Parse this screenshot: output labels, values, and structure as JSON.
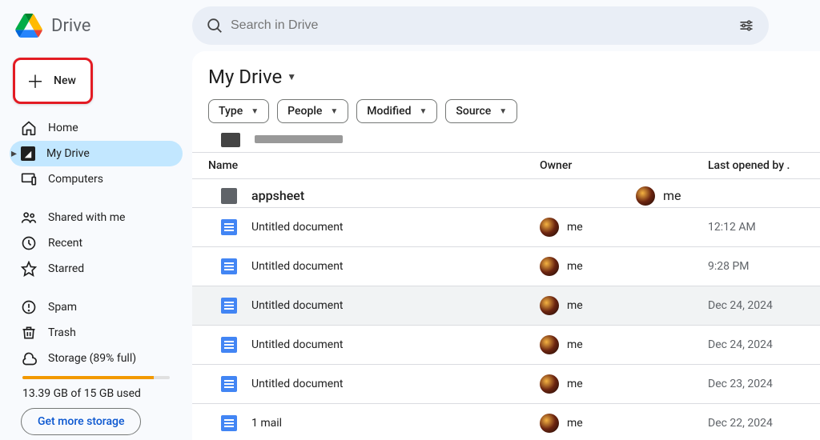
{
  "app": {
    "name": "Drive"
  },
  "search": {
    "placeholder": "Search in Drive"
  },
  "new_button": {
    "label": "New"
  },
  "sidebar": {
    "items": [
      {
        "label": "Home",
        "icon": "home-icon"
      },
      {
        "label": "My Drive",
        "icon": "drive-icon",
        "active": true
      },
      {
        "label": "Computers",
        "icon": "computers-icon"
      },
      {
        "label": "Shared with me",
        "icon": "shared-icon"
      },
      {
        "label": "Recent",
        "icon": "recent-icon"
      },
      {
        "label": "Starred",
        "icon": "starred-icon"
      },
      {
        "label": "Spam",
        "icon": "spam-icon"
      },
      {
        "label": "Trash",
        "icon": "trash-icon"
      },
      {
        "label": "Storage (89% full)",
        "icon": "storage-icon"
      }
    ]
  },
  "storage": {
    "percent": 89,
    "text": "13.39 GB of 15 GB used",
    "button": "Get more storage"
  },
  "breadcrumb": {
    "title": "My Drive"
  },
  "filters": [
    {
      "label": "Type"
    },
    {
      "label": "People"
    },
    {
      "label": "Modified"
    },
    {
      "label": "Source"
    }
  ],
  "columns": {
    "name": "Name",
    "owner": "Owner",
    "date": "Last opened by ."
  },
  "rows": [
    {
      "name": "appsheet",
      "owner": "me",
      "date": "",
      "type": "folder"
    },
    {
      "name": "Untitled document",
      "owner": "me",
      "date": "12:12 AM",
      "type": "doc"
    },
    {
      "name": "Untitled document",
      "owner": "me",
      "date": "9:28 PM",
      "type": "doc"
    },
    {
      "name": "Untitled document",
      "owner": "me",
      "date": "Dec 24, 2024",
      "type": "doc",
      "hover": true
    },
    {
      "name": "Untitled document",
      "owner": "me",
      "date": "Dec 24, 2024",
      "type": "doc"
    },
    {
      "name": "Untitled document",
      "owner": "me",
      "date": "Dec 23, 2024",
      "type": "doc"
    },
    {
      "name": "1 mail",
      "owner": "me",
      "date": "Dec 22, 2024",
      "type": "doc"
    }
  ]
}
